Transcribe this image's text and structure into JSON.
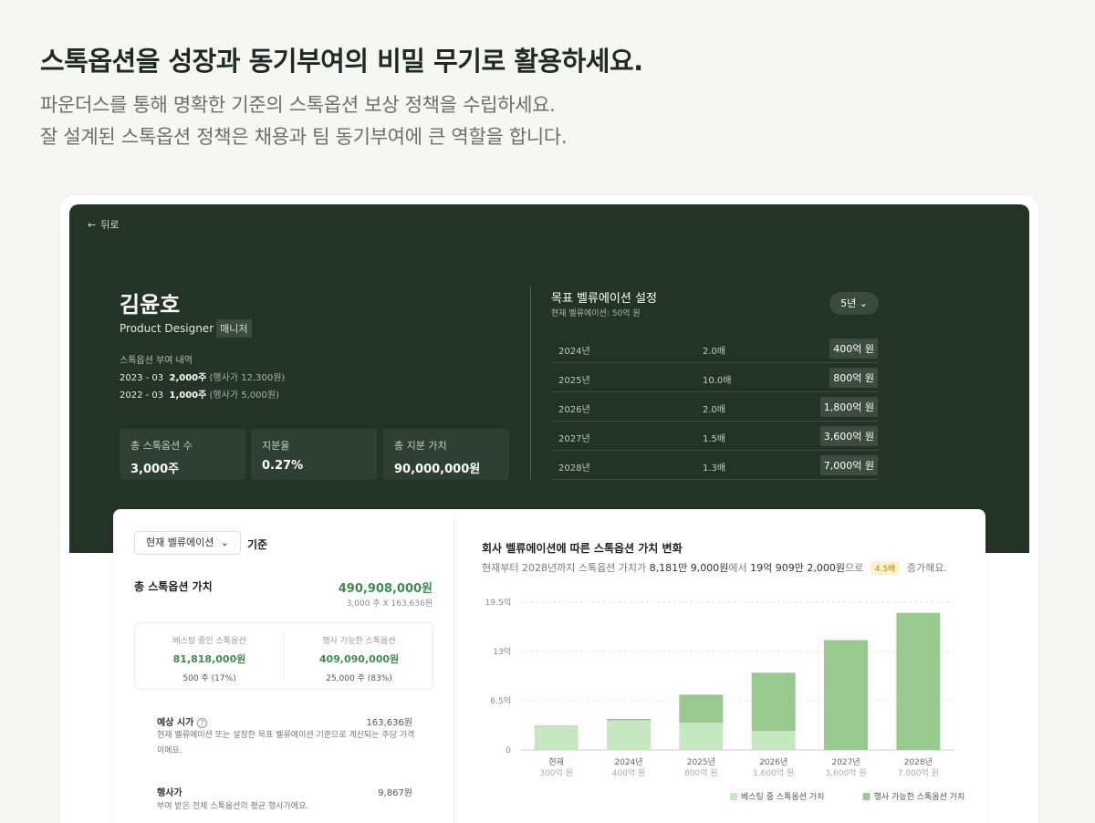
{
  "headline": "스톡옵션을 성장과 동기부여의  비밀 무기로 활용하세요.",
  "sub_line1": "파운더스를 통해 명확한 기준의 스톡옵션 보상 정책을 수립하세요.",
  "sub_line2": "잘 설계된 스톡옵션 정책은 채용과 팀 동기부여에 큰 역할을 합니다.",
  "profile": {
    "back_label": "뒤로",
    "name": "김윤호",
    "role": "Product Designer",
    "badge": "매니저",
    "grant_title": "스톡옵션 부여 내역",
    "grants": [
      {
        "date": "2023 - 03",
        "shares": "2,000주",
        "note": "(행사가 12,300원)"
      },
      {
        "date": "2022 - 03",
        "shares": "1,000주",
        "note": "(행사가 5,000원)"
      }
    ],
    "stats": [
      {
        "label": "총 스톡옵션 수",
        "value": "3,000주"
      },
      {
        "label": "지분율",
        "value": "0.27%"
      },
      {
        "label": "총 지분 가치",
        "value": "90,000,000원"
      }
    ]
  },
  "valuation": {
    "title": "목표 벨류에이션 설정",
    "subtitle": "현재 벨류에이션: 50억 원",
    "period": "5년",
    "rows": [
      {
        "year": "2024년",
        "multiple": "2.0배",
        "amount": "400억 원"
      },
      {
        "year": "2025년",
        "multiple": "10.0배",
        "amount": "800억 원"
      },
      {
        "year": "2026년",
        "multiple": "2.0배",
        "amount": "1,800억 원"
      },
      {
        "year": "2027년",
        "multiple": "1.5배",
        "amount": "3,600억 원"
      },
      {
        "year": "2028년",
        "multiple": "1.3배",
        "amount": "7,000억 원"
      }
    ]
  },
  "summary": {
    "basis_select": "현재 벨류에이션",
    "basis_label": "기준",
    "total_label": "총 스톡옵션 가치",
    "total_value": "490,908,000원",
    "total_sub": "3,000 주 X 163,636원",
    "vesting_label": "베스팅 중인 스톡옵션",
    "vesting_value": "81,818,000원",
    "vesting_sub": "500 주 (17%)",
    "exercisable_label": "행사 가능한 스톡옵션",
    "exercisable_value": "409,090,000원",
    "exercisable_sub": "25,000 주 (83%)",
    "expected_label": "예상 시가",
    "expected_value": "163,636원",
    "expected_desc1": "현재 벨류에이션 또는 설정한 목표 벨류에이션 기준으로 계산되는 주당 가격",
    "expected_desc2": "이에요.",
    "strike_label": "행사가",
    "strike_value": "9,867원",
    "strike_desc": "부여 받은 전체 스톡옵션의 평균 행사가에요."
  },
  "chart_header": {
    "title": "회사 벨류에이션에 따른 스톡옵션 가치 변화",
    "desc_prefix": "현재부터 2028년까지 스톡옵션 가치가",
    "desc_from": "8,181만 9,000원",
    "desc_mid": "에서",
    "desc_to": "19억 909만 2,000원",
    "desc_suffix1": "으로",
    "multiplier": "4.5배",
    "desc_suffix2": "증가해요."
  },
  "chart_data": {
    "type": "bar",
    "stacked": true,
    "categories": [
      "현재",
      "2024년",
      "2025년",
      "2026년",
      "2027년",
      "2028년"
    ],
    "category_sublabels": [
      "300억 원",
      "400억 원",
      "800억 원",
      "1,600억 원",
      "3,600억 원",
      "7,000억 원"
    ],
    "series": [
      {
        "name": "베스팅 중 스톡옵션 가치",
        "color": "#c6e7c2",
        "values": [
          3.1,
          3.9,
          3.6,
          2.5,
          0,
          0
        ]
      },
      {
        "name": "행사 가능한 스톡옵션 가치",
        "color": "#98c98f",
        "values": [
          0.1,
          0.2,
          3.7,
          7.7,
          14.5,
          18.1
        ]
      }
    ],
    "yticks": [
      0,
      6.5,
      13,
      19.5
    ],
    "ytick_labels": [
      "0",
      "6.5억",
      "13억",
      "19.5억"
    ],
    "ylim": [
      0,
      19.5
    ],
    "grid": true,
    "legend_position": "bottom"
  }
}
